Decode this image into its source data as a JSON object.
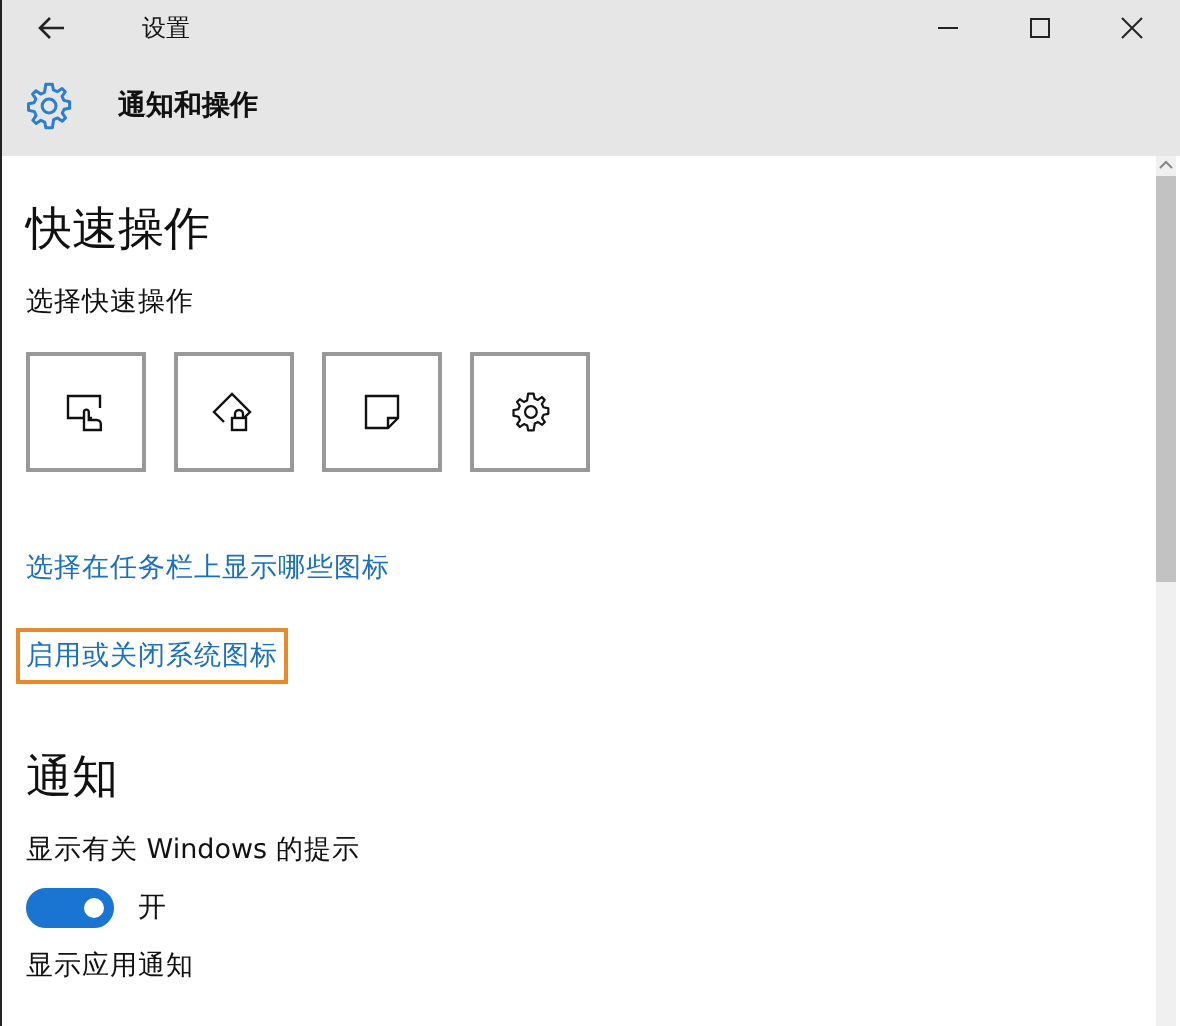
{
  "window": {
    "title": "设置"
  },
  "header": {
    "title": "通知和操作"
  },
  "quick_actions": {
    "heading": "快速操作",
    "label": "选择快速操作",
    "tiles": [
      {
        "kind": "tablet"
      },
      {
        "kind": "lock"
      },
      {
        "kind": "note"
      },
      {
        "kind": "settings"
      }
    ]
  },
  "links": [
    {
      "text": "选择在任务栏上显示哪些图标",
      "highlighted": false
    },
    {
      "text": "启用或关闭系统图标",
      "highlighted": true
    }
  ],
  "notifications": {
    "heading": "通知",
    "settings": [
      {
        "label": "显示有关 Windows 的提示",
        "on": true,
        "state_text": "开"
      },
      {
        "label": "显示应用通知"
      }
    ]
  }
}
